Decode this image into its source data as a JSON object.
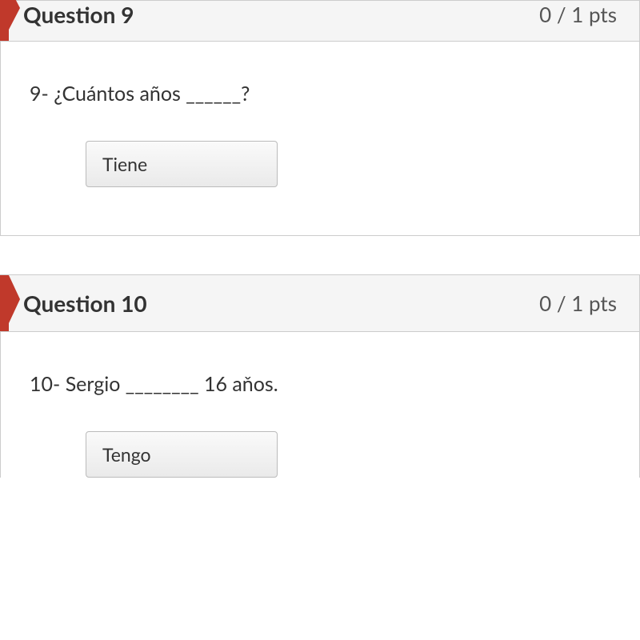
{
  "questions": [
    {
      "title": "Question 9",
      "points": "0 / 1 pts",
      "prompt": "9- ¿Cuántos años ______?",
      "answer": "Tiene"
    },
    {
      "title": "Question 10",
      "points": "0 / 1 pts",
      "prompt": "10- Sergio ________ 16 aňos.",
      "answer": "Tengo"
    }
  ]
}
